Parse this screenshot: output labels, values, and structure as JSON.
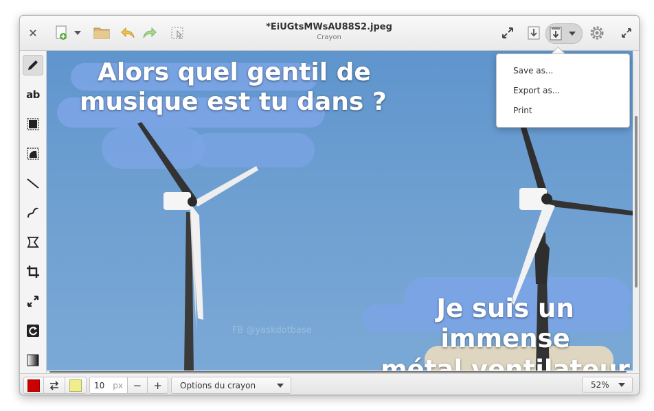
{
  "header": {
    "title": "*EiUGtsMWsAU88S2.jpeg",
    "subtitle": "Crayon",
    "close_icon": "close-icon",
    "new_icon": "new-image-icon",
    "open_icon": "folder-icon",
    "undo_icon": "undo-icon",
    "redo_icon": "redo-icon",
    "selection_icon": "selection-icon",
    "fullscreen_icon": "expand-icon",
    "import_icon": "import-icon",
    "save_icon": "save-icon",
    "settings_icon": "gear-icon",
    "maximize_icon": "maximize-icon"
  },
  "save_menu": {
    "items": [
      "Save as...",
      "Export as...",
      "Print"
    ]
  },
  "left_toolbar": {
    "tools": [
      "pencil",
      "text",
      "rectangle-selection",
      "free-selection",
      "line",
      "curve",
      "shape",
      "crop",
      "scale",
      "rotate",
      "filters"
    ],
    "text_tool_label": "ab"
  },
  "canvas": {
    "caption_top_line1": "Alors quel gentil de",
    "caption_top_line2": "musique est tu dans ?",
    "caption_bottom_line1": "Je suis un immense",
    "caption_bottom_line2": "métal ventilateur",
    "watermark": "FB @yaskdotbase"
  },
  "bottom_bar": {
    "main_color": "#cc0000",
    "secondary_color": "#f0ee8a",
    "size_value": "10",
    "size_unit": "px",
    "minus_label": "−",
    "plus_label": "+",
    "options_label": "Options du crayon",
    "zoom_label": "52%"
  }
}
